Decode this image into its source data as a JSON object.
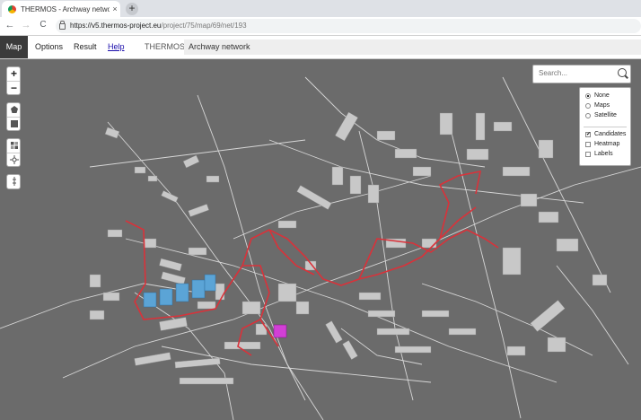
{
  "browser": {
    "tab_title": "THERMOS - Archway network",
    "tab_close": "×",
    "new_tab": "+",
    "url_host": "https://v5.thermos-project.eu",
    "url_path": "/project/75/map/69/net/193",
    "back": "←",
    "forward": "→",
    "reload": "C"
  },
  "app": {
    "tabs": [
      {
        "label": "Map"
      },
      {
        "label": "Options"
      },
      {
        "label": "Result"
      },
      {
        "label": "Help"
      }
    ],
    "brand": "THERMOS",
    "project_name": "Archway network"
  },
  "map": {
    "zoom_in": "+",
    "zoom_out": "−",
    "search_placeholder": "Search...",
    "basemap_options": [
      "None",
      "Maps",
      "Satellite"
    ],
    "basemap_selected": "None",
    "overlay_options": [
      {
        "label": "Candidates",
        "checked": true
      },
      {
        "label": "Heatmap",
        "checked": false
      },
      {
        "label": "Labels",
        "checked": false
      }
    ],
    "colors": {
      "background": "#6b6b6b",
      "building": "#c8c8c8",
      "road": "#d6d6d6",
      "network": "#d9323a",
      "supply": "#d23fd6",
      "selected": "#5ba4d6"
    }
  }
}
